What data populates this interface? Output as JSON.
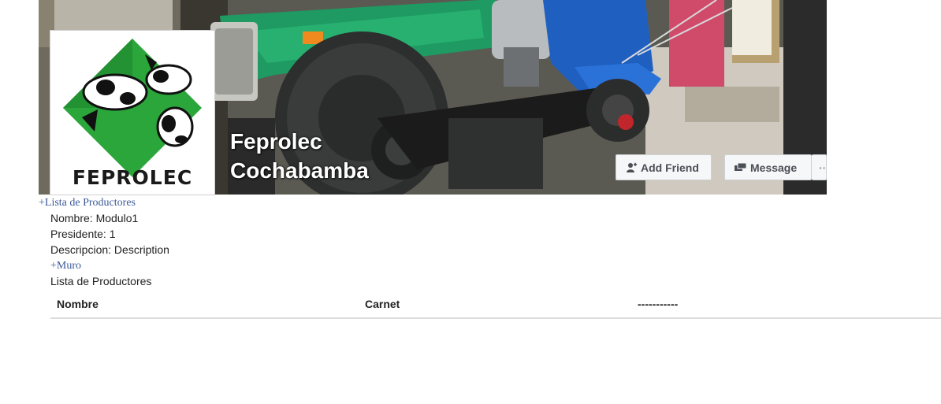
{
  "profile": {
    "name_line1": "Feprolec",
    "name_line2": "Cochabamba",
    "logo_text": "FEPROLEC"
  },
  "actions": {
    "add_friend": "Add Friend",
    "message": "Message",
    "more": "···"
  },
  "icons": {
    "add_friend": "add-person-icon",
    "message": "chat-bubbles-icon"
  },
  "links": {
    "lista": "+Lista de Productores",
    "muro": "+Muro"
  },
  "module": {
    "nombre": "Nombre: Modulo1",
    "presidente": "Presidente: 1",
    "descripcion": "Descripcion: Description",
    "lista_title": "Lista de Productores"
  },
  "table": {
    "headers": [
      "Nombre",
      "Carnet",
      "-----------"
    ],
    "rows": []
  },
  "colors": {
    "link": "#3b5998",
    "logo_green": "#2aa63a",
    "button_bg": "#f6f7f9"
  }
}
